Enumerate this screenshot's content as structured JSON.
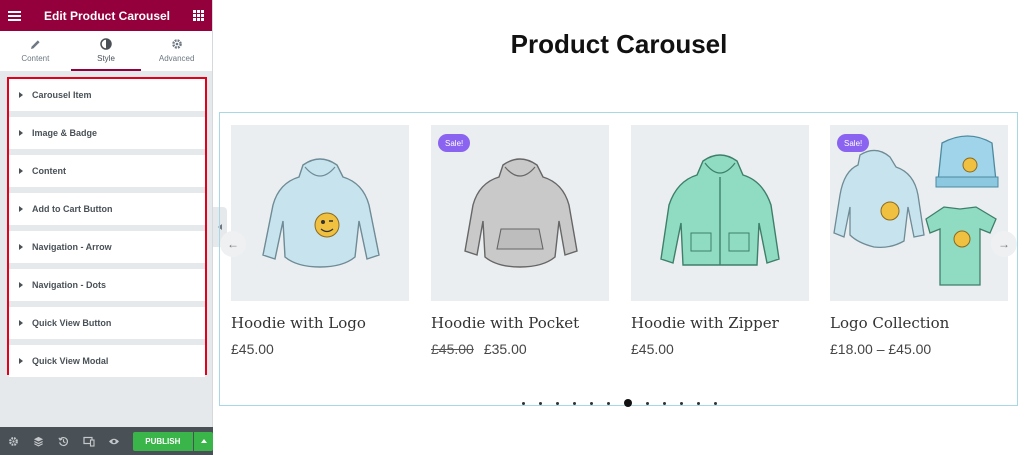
{
  "panel": {
    "title": "Edit Product Carousel",
    "tabs": [
      {
        "label": "Content",
        "icon": "pencil-icon"
      },
      {
        "label": "Style",
        "icon": "contrast-icon",
        "active": true
      },
      {
        "label": "Advanced",
        "icon": "gear-icon"
      }
    ],
    "sections": [
      "Carousel Item",
      "Image & Badge",
      "Content",
      "Add to Cart Button",
      "Navigation - Arrow",
      "Navigation - Dots",
      "Quick View Button",
      "Quick View Modal"
    ],
    "footer": {
      "icons": [
        "settings-icon",
        "layers-icon",
        "history-icon",
        "responsive-icon",
        "eye-icon"
      ],
      "publish_label": "PUBLISH"
    },
    "colors": {
      "brand": "#93003c",
      "publish": "#39b54a",
      "highlight_border": "#e2001a"
    }
  },
  "preview": {
    "page_title": "Product Carousel",
    "products": [
      {
        "name": "Hoodie with Logo",
        "price": "£45.00",
        "sale": false,
        "image": "hoodie-logo"
      },
      {
        "name": "Hoodie with Pocket",
        "old_price": "£45.00",
        "price": "£35.00",
        "sale": true,
        "badge": "Sale!",
        "image": "hoodie-pocket"
      },
      {
        "name": "Hoodie with Zipper",
        "price": "£45.00",
        "sale": false,
        "image": "hoodie-zipper"
      },
      {
        "name": "Logo Collection",
        "price": "£18.00 – £45.00",
        "sale": true,
        "badge": "Sale!",
        "image": "logo-collection"
      }
    ],
    "nav": {
      "prev_icon": "arrow-left-icon",
      "next_icon": "arrow-right-icon",
      "prev_glyph": "←",
      "next_glyph": "→"
    },
    "dots": {
      "count": 12,
      "active_index": 6
    },
    "colors": {
      "sale_badge": "#8a63f0",
      "carousel_border": "#a8d8e5"
    }
  }
}
